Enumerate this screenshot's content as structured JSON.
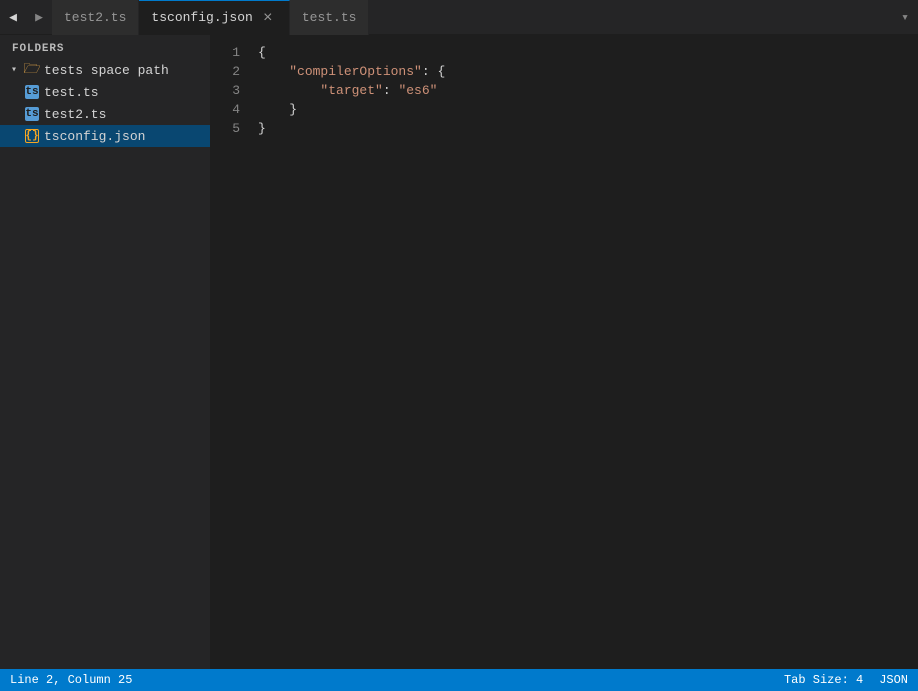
{
  "sidebar": {
    "header": "FOLDERS",
    "root": {
      "label": "tests space path",
      "expanded": true,
      "children": [
        {
          "name": "test.ts",
          "type": "ts"
        },
        {
          "name": "test2.ts",
          "type": "ts"
        },
        {
          "name": "tsconfig.json",
          "type": "json",
          "selected": true
        }
      ]
    }
  },
  "tabs": [
    {
      "id": "test2",
      "label": "test2.ts",
      "active": false,
      "closable": false
    },
    {
      "id": "tsconfig",
      "label": "tsconfig.json",
      "active": true,
      "closable": true
    },
    {
      "id": "test",
      "label": "test.ts",
      "active": false,
      "closable": false
    }
  ],
  "editor": {
    "language": "JSON",
    "lines": [
      {
        "num": "1",
        "content": "{",
        "tokens": [
          {
            "text": "{",
            "class": "brace"
          }
        ]
      },
      {
        "num": "2",
        "content": "    \"compilerOptions\": {",
        "tokens": [
          {
            "text": "    ",
            "class": ""
          },
          {
            "text": "\"compilerOptions\"",
            "class": "json-key-str"
          },
          {
            "text": ": ",
            "class": "brace"
          },
          {
            "text": "{",
            "class": "brace"
          }
        ]
      },
      {
        "num": "3",
        "content": "        \"target\": \"es6\"",
        "tokens": [
          {
            "text": "        ",
            "class": ""
          },
          {
            "text": "\"target\"",
            "class": "json-key-str"
          },
          {
            "text": ": ",
            "class": "brace"
          },
          {
            "text": "\"es6\"",
            "class": "string-val"
          }
        ]
      },
      {
        "num": "4",
        "content": "    }",
        "tokens": [
          {
            "text": "    ",
            "class": ""
          },
          {
            "text": "}",
            "class": "brace"
          }
        ]
      },
      {
        "num": "5",
        "content": "}",
        "tokens": [
          {
            "text": "}",
            "class": "brace"
          }
        ]
      }
    ]
  },
  "statusbar": {
    "position": "Line 2, Column 25",
    "tab_size": "Tab Size: 4",
    "language": "JSON"
  },
  "nav": {
    "back_label": "◀",
    "forward_label": "▶",
    "overflow_label": "▾"
  }
}
